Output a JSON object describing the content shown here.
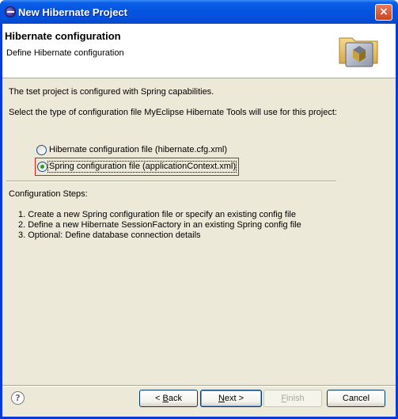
{
  "window": {
    "title": "New Hibernate Project",
    "close_label": "×"
  },
  "header": {
    "title": "Hibernate configuration",
    "description": "Define Hibernate configuration"
  },
  "content": {
    "project_info": "The tset project is configured with Spring capabilities.",
    "select_prompt": "Select the type of configuration file MyEclipse Hibernate Tools will use for this project:",
    "options": [
      {
        "label": "Hibernate configuration file (hibernate.cfg.xml)",
        "selected": false
      },
      {
        "label": "Spring configuration file (applicationContext.xml)",
        "selected": true
      }
    ],
    "steps_title": "Configuration Steps:",
    "steps": [
      "1. Create a new Spring configuration file or specify an existing config file",
      "2. Define a new Hibernate SessionFactory in an existing Spring config file",
      "3. Optional: Define database connection details"
    ]
  },
  "footer": {
    "help_icon": "?",
    "back": {
      "prefix": "< ",
      "mnemonic": "B",
      "rest": "ack"
    },
    "next": {
      "mnemonic": "N",
      "rest": "ext >"
    },
    "finish": {
      "mnemonic": "F",
      "rest": "inish",
      "enabled": false
    },
    "cancel": {
      "label": "Cancel"
    }
  },
  "colors": {
    "titlebar": "#0454e0",
    "dialog_bg": "#ece9d8",
    "highlight_border": "#e81818",
    "radio_selected": "#21a121"
  }
}
